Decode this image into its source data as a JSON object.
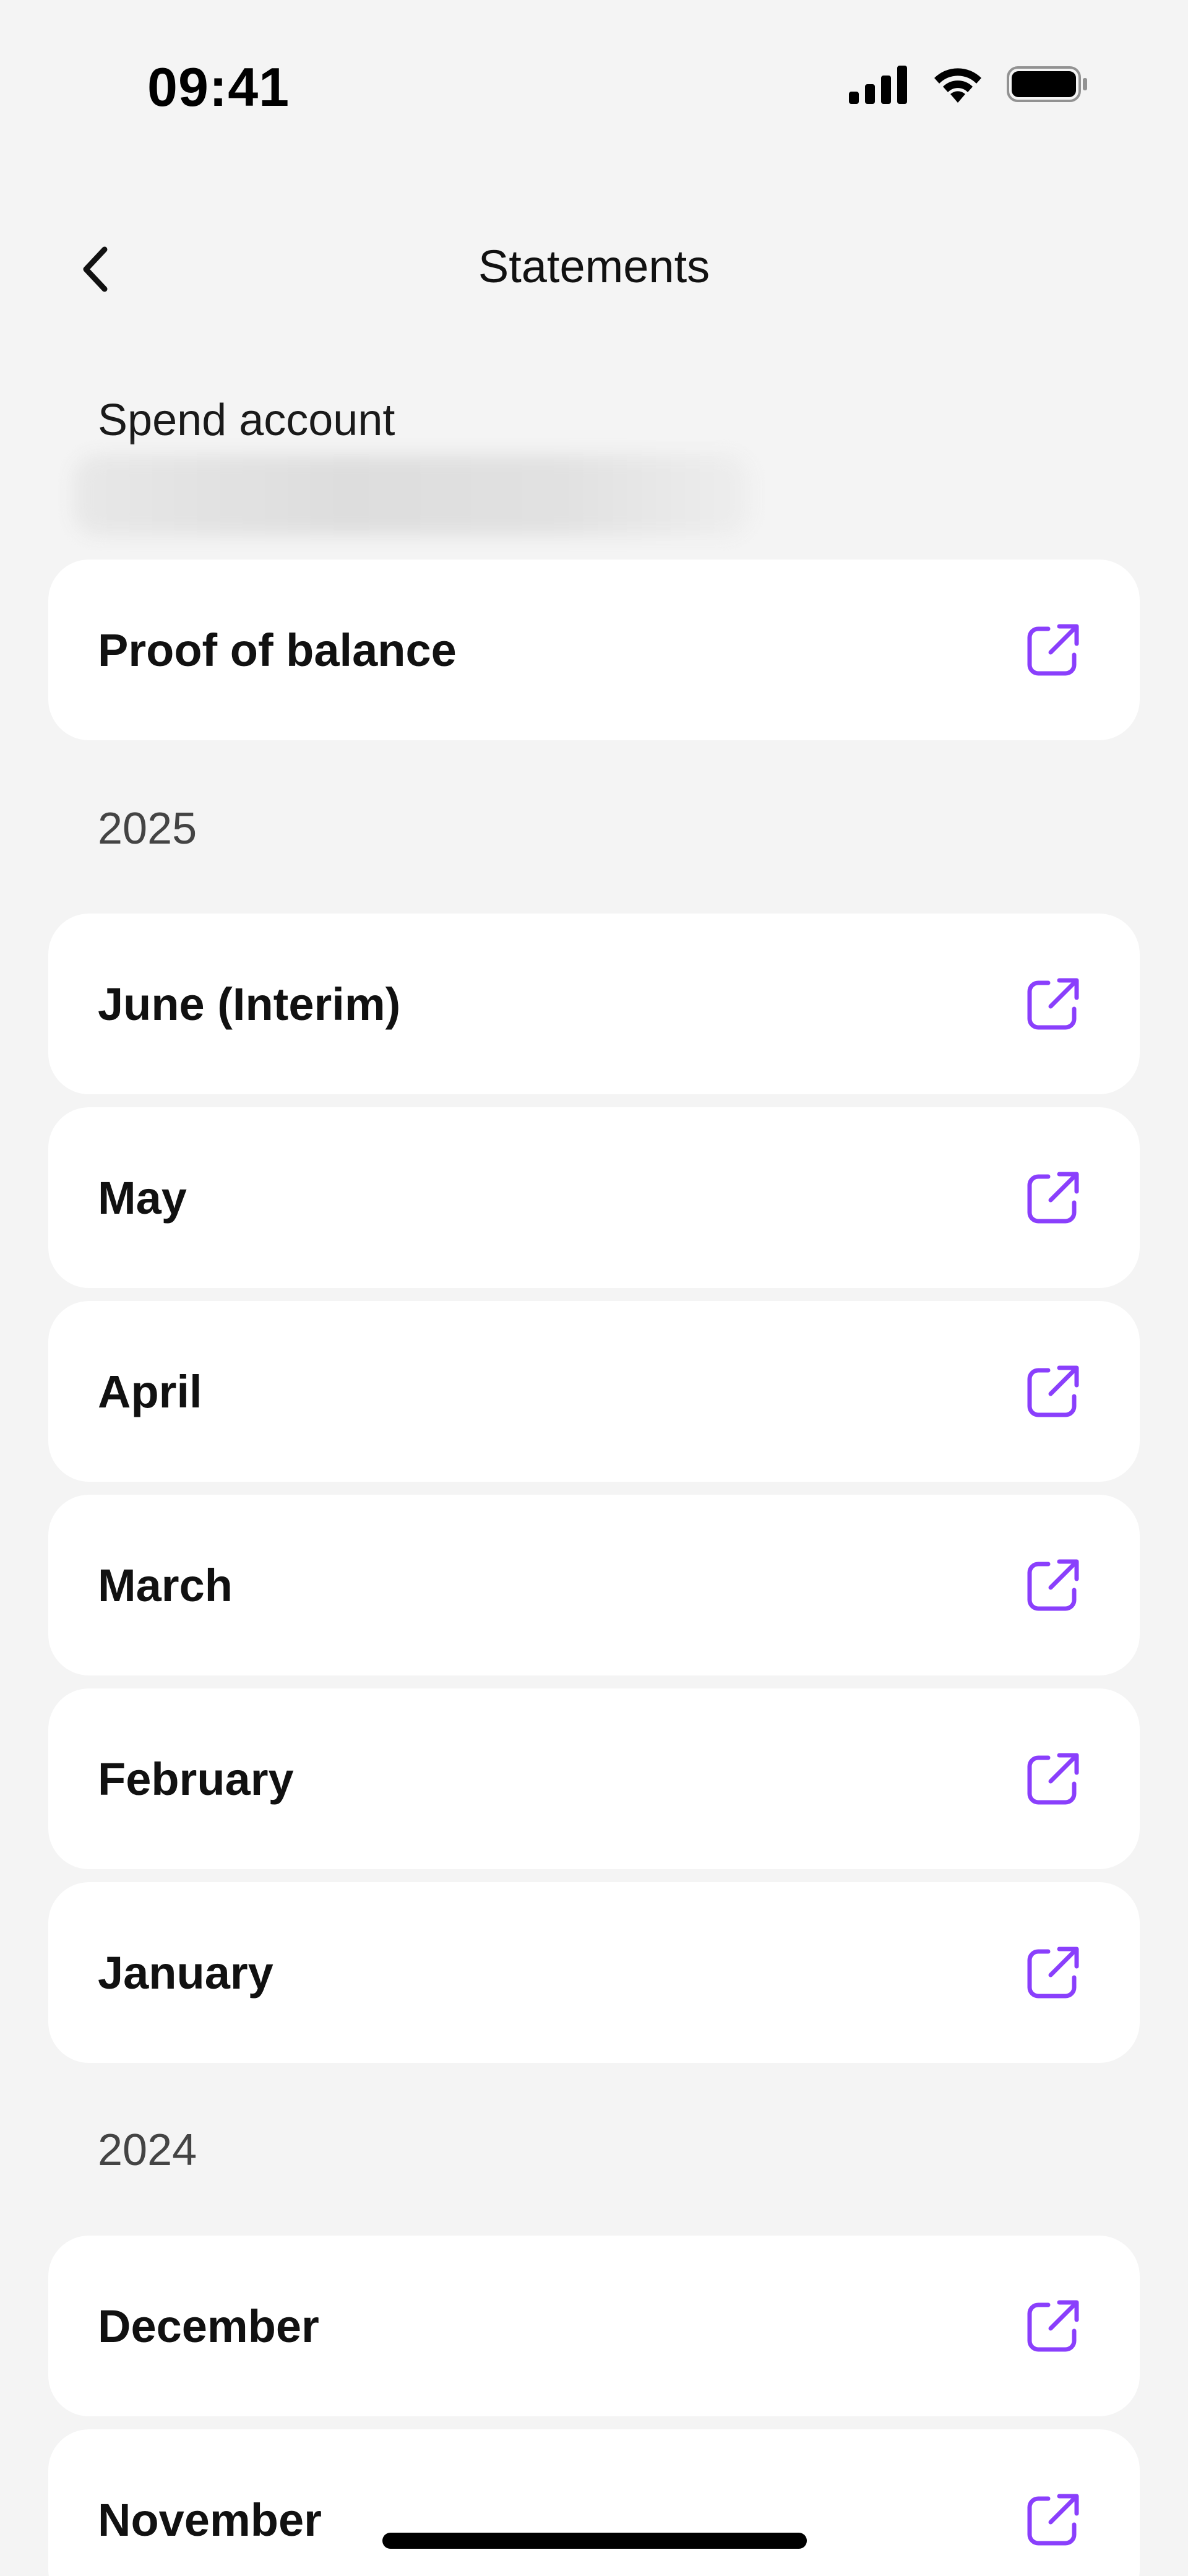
{
  "status_bar": {
    "time": "09:41",
    "icons": [
      "cellular-signal-icon",
      "wifi-icon",
      "battery-icon"
    ]
  },
  "nav": {
    "back_icon": "chevron-left-icon",
    "title": "Statements"
  },
  "account": {
    "label": "Spend account",
    "number_blurred": true
  },
  "proof_of_balance": {
    "label": "Proof of balance",
    "icon": "external-link-icon"
  },
  "sections": [
    {
      "year": "2025",
      "items": [
        {
          "label": "June (Interim)",
          "icon": "external-link-icon"
        },
        {
          "label": "May",
          "icon": "external-link-icon"
        },
        {
          "label": "April",
          "icon": "external-link-icon"
        },
        {
          "label": "March",
          "icon": "external-link-icon"
        },
        {
          "label": "February",
          "icon": "external-link-icon"
        },
        {
          "label": "January",
          "icon": "external-link-icon"
        }
      ]
    },
    {
      "year": "2024",
      "items": [
        {
          "label": "December",
          "icon": "external-link-icon"
        },
        {
          "label": "November",
          "icon": "external-link-icon"
        }
      ]
    }
  ],
  "colors": {
    "background": "#f4f4f4",
    "card": "#ffffff",
    "accent": "#8a3ffc",
    "text": "#111111",
    "muted_text": "#444444"
  }
}
